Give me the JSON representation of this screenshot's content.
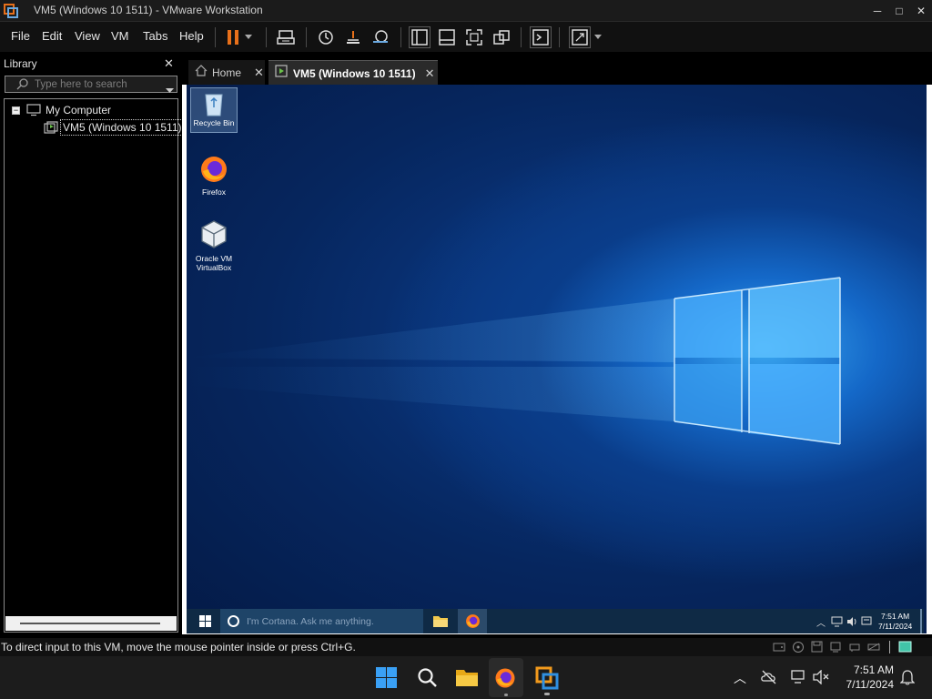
{
  "window": {
    "title": "VM5 (Windows 10 1511) - VMware Workstation",
    "minimize_glyph": "─",
    "maximize_glyph": "□",
    "close_glyph": "✕"
  },
  "menu": {
    "items": [
      "File",
      "Edit",
      "View",
      "VM",
      "Tabs",
      "Help"
    ]
  },
  "toolbar": {
    "icons": [
      "pause-icon",
      "dropdown-arrow-icon",
      "send-ctrl-alt-del-icon",
      "snapshot-icon",
      "revert-snapshot-icon",
      "snapshot-manager-icon",
      "show-library-icon",
      "thumbnail-bar-icon",
      "full-screen-icon",
      "unity-icon",
      "console-view-icon",
      "stretch-guest-icon",
      "dropdown-arrow-icon"
    ],
    "accent": "#e8701a"
  },
  "library": {
    "title": "Library",
    "search_placeholder": "Type here to search",
    "tree": {
      "root_label": "My Computer",
      "expander": "−",
      "children": [
        "VM5 (Windows 10 1511)"
      ]
    }
  },
  "tabs": [
    {
      "label": "Home",
      "icon": "home-icon",
      "active": false
    },
    {
      "label": "VM5 (Windows 10 1511)",
      "icon": "vm-icon",
      "active": true
    }
  ],
  "guest": {
    "desktop_icons": [
      {
        "label": "Recycle Bin",
        "icon": "recycle-bin-icon"
      },
      {
        "label": "Firefox",
        "icon": "firefox-icon"
      },
      {
        "label_line1": "Oracle VM",
        "label_line2": "VirtualBox",
        "icon": "virtualbox-icon"
      }
    ],
    "taskbar": {
      "search_placeholder": "I'm Cortana. Ask me anything.",
      "clock_time": "7:51 AM",
      "clock_date": "7/11/2024"
    }
  },
  "status": {
    "text": "To direct input to this VM, move the mouse pointer inside or press Ctrl+G."
  },
  "host_taskbar": {
    "clock_time": "7:51 AM",
    "clock_date": "7/11/2024"
  }
}
